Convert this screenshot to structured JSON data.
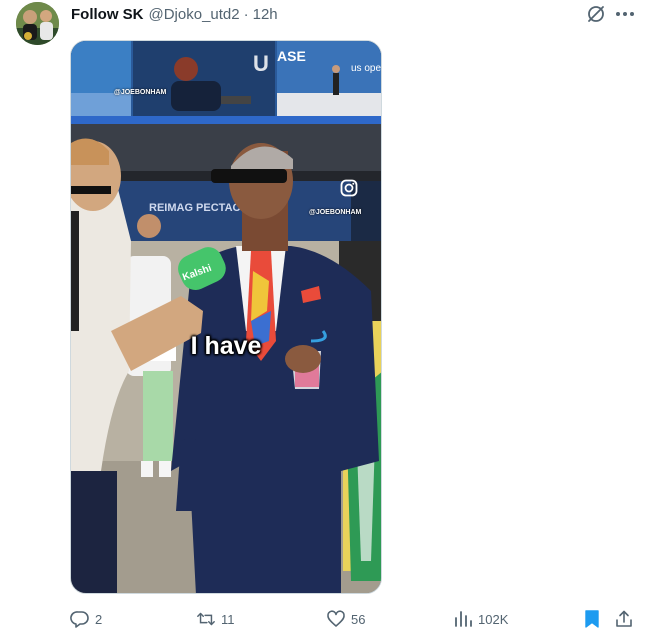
{
  "post": {
    "author_name": "Follow SK",
    "author_handle": "@Djoko_utd2",
    "separator": "·",
    "time": "12h"
  },
  "media": {
    "caption": "I have",
    "watermark_top": "@JOEBONHAM",
    "watermark_mid": "@JOEBONHAM",
    "mic_brand": "Kalshi",
    "banner_text": "REIMAG PECTAC",
    "scoreboard_text": "ASE",
    "us_open_text": "us ope"
  },
  "actions": {
    "replies": "2",
    "reposts": "11",
    "likes": "56",
    "views": "102K"
  },
  "colors": {
    "accent": "#1d9bf0",
    "muted": "#536471",
    "text": "#0f1419"
  },
  "icons": [
    "grok-icon",
    "more-icon",
    "reply-icon",
    "repost-icon",
    "like-icon",
    "views-icon",
    "bookmark-icon",
    "share-icon",
    "instagram-icon"
  ]
}
